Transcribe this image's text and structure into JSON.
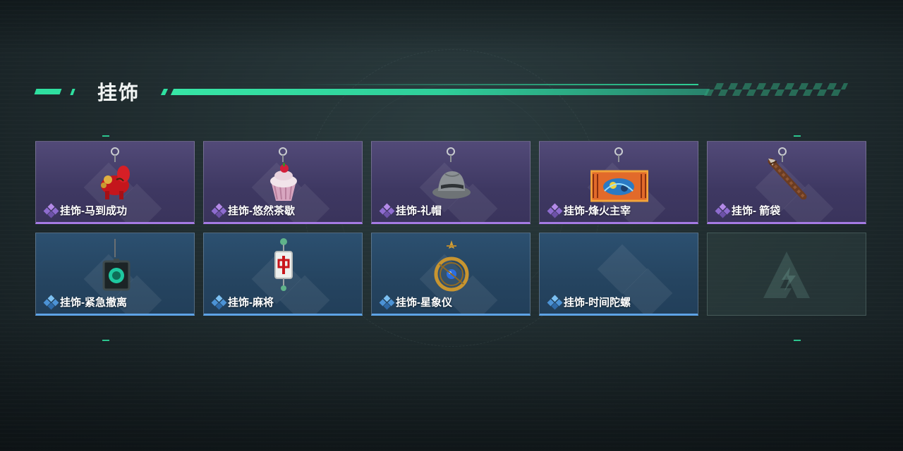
{
  "header": {
    "title": "挂饰"
  },
  "colors": {
    "accent": "#2fe0a0",
    "epic_border": "#a57ae4",
    "rare_border": "#5ea3e6",
    "epic_bg": "#463f6c",
    "rare_bg": "#284a68"
  },
  "items": [
    {
      "label": "挂饰-马到成功",
      "rarity": "epic",
      "icon": "red-horse-charm-icon"
    },
    {
      "label": "挂饰-悠然茶歇",
      "rarity": "epic",
      "icon": "cupcake-charm-icon"
    },
    {
      "label": "挂饰-礼帽",
      "rarity": "epic",
      "icon": "fedora-hat-charm-icon"
    },
    {
      "label": "挂饰-烽火主宰",
      "rarity": "epic",
      "icon": "ticket-banner-charm-icon"
    },
    {
      "label": "挂饰- 箭袋",
      "rarity": "epic",
      "icon": "arrow-quiver-charm-icon"
    },
    {
      "label": "挂饰-紧急撤离",
      "rarity": "rare",
      "icon": "green-emblem-charm-icon"
    },
    {
      "label": "挂饰-麻将",
      "rarity": "rare",
      "icon": "mahjong-tile-charm-icon"
    },
    {
      "label": "挂饰-星象仪",
      "rarity": "rare",
      "icon": "astrolabe-charm-icon"
    },
    {
      "label": "挂饰-时间陀螺",
      "rarity": "rare",
      "icon": "empty-placeholder"
    },
    {
      "label": "",
      "rarity": "empty",
      "icon": "game-logo-icon"
    }
  ]
}
